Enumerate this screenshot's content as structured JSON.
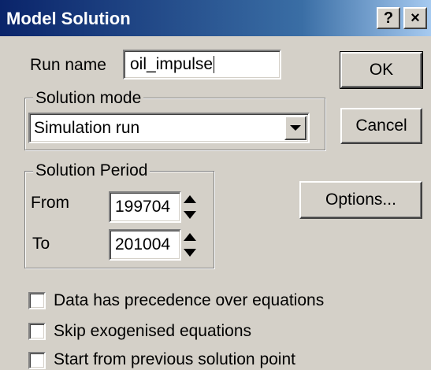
{
  "window": {
    "title": "Model Solution",
    "help_label": "?",
    "close_label": "×"
  },
  "run_name": {
    "label": "Run name",
    "value": "oil_impulse"
  },
  "solution_mode": {
    "group_label": "Solution mode",
    "selected": "Simulation run"
  },
  "solution_period": {
    "group_label": "Solution Period",
    "from_label": "From",
    "from_value": "199704",
    "to_label": "To",
    "to_value": "201004"
  },
  "buttons": {
    "ok": "OK",
    "cancel": "Cancel",
    "options": "Options..."
  },
  "checkboxes": [
    {
      "label": "Data has precedence over equations",
      "checked": false
    },
    {
      "label": "Skip exogenised equations",
      "checked": false
    },
    {
      "label": "Start from previous solution point",
      "checked": false
    }
  ],
  "icons": {
    "dropdown": "chevron-down-icon",
    "spin_up": "triangle-up-icon",
    "spin_down": "triangle-down-icon"
  },
  "colors": {
    "titlebar_start": "#0a246a",
    "titlebar_end": "#a6caf0",
    "dialog_face": "#d4d0c8"
  }
}
